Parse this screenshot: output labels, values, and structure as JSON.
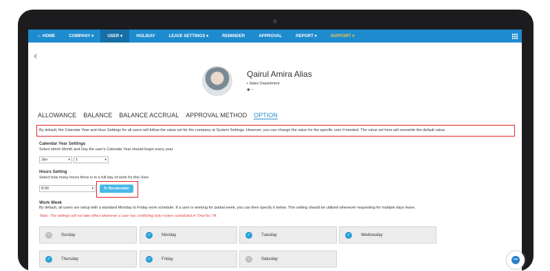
{
  "nav": {
    "items": [
      "HOME",
      "COMPANY ▾",
      "USER ▾",
      "HOLIDAY",
      "LEAVE SETTINGS ▾",
      "REMINDER",
      "APPROVAL",
      "REPORT ▾",
      "SUPPORT ▾"
    ],
    "home_icon": "home-icon",
    "apps_icon": "grid-icon"
  },
  "profile": {
    "name": "Qairul Amira Alias",
    "department": "Sales Department",
    "secondary": "–"
  },
  "tabs": [
    "ALLOWANCE",
    "BALANCE",
    "BALANCE ACCRUAL",
    "APPROVAL METHOD",
    "OPTION"
  ],
  "notice": "By default, the Calendar Year and Hour Settings for all users will follow the value set for the company at System Settings. However, you can change the value for the specific user if needed. The value set here will overwrite the default value.",
  "calendar": {
    "title": "Calendar Year Settings",
    "desc": "Select which Month and Day the user's Calendar Year should begin every year",
    "month": "Jan",
    "day": "1"
  },
  "hours": {
    "title": "Hours Setting",
    "desc": "Select how many hours there is in a full day of work for this User.",
    "value": "8.00",
    "recalc_label": "Recalculate"
  },
  "work_week": {
    "title": "Work Week",
    "desc": "By default, all users are setup with a standard Monday to Friday work schedule. If a user is working for partial week, you can then specify it below. This setting should be utilized whenever requesting for multiple days leave.",
    "note": "Note: The settings will not take effect whenever a user has conflicting duty rosters scheduled in TimeTec TA.",
    "days": [
      {
        "label": "Sunday",
        "checked": false
      },
      {
        "label": "Monday",
        "checked": true
      },
      {
        "label": "Tuesday",
        "checked": true
      },
      {
        "label": "Wednesday",
        "checked": true
      },
      {
        "label": "Thursday",
        "checked": true
      },
      {
        "label": "Friday",
        "checked": true
      },
      {
        "label": "Saturday",
        "checked": false
      }
    ]
  },
  "colors": {
    "accent": "#1e8bcf",
    "highlight": "#e02020"
  }
}
